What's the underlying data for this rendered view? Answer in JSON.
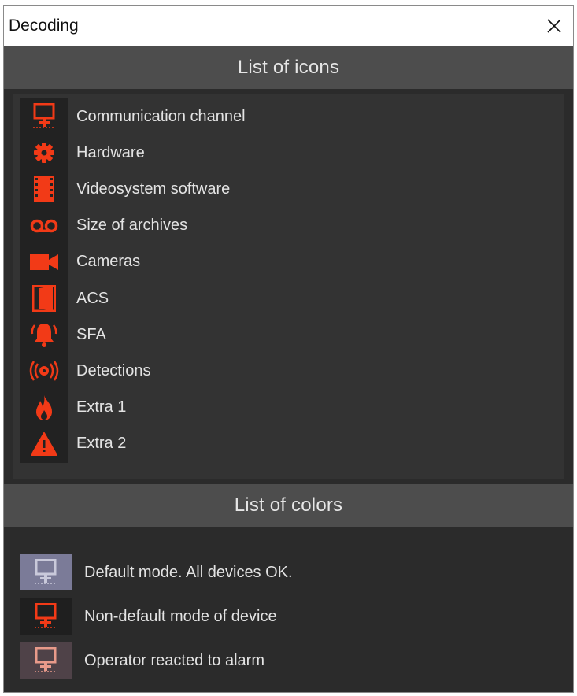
{
  "window": {
    "title": "Decoding"
  },
  "icons_section": {
    "header": "List of icons",
    "items": [
      {
        "icon": "monitor-network-icon",
        "label": "Communication channel"
      },
      {
        "icon": "gear-icon",
        "label": "Hardware"
      },
      {
        "icon": "film-strip-icon",
        "label": "Videosystem software"
      },
      {
        "icon": "voicemail-tape-icon",
        "label": "Size of archives"
      },
      {
        "icon": "video-camera-icon",
        "label": "Cameras"
      },
      {
        "icon": "door-icon",
        "label": "ACS"
      },
      {
        "icon": "alarm-bell-icon",
        "label": "SFA"
      },
      {
        "icon": "broadcast-signal-icon",
        "label": "Detections"
      },
      {
        "icon": "flame-icon",
        "label": "Extra 1"
      },
      {
        "icon": "warning-triangle-icon",
        "label": "Extra 2"
      }
    ]
  },
  "colors_section": {
    "header": "List of colors",
    "items": [
      {
        "label": "Default mode. All devices OK.",
        "swatch_bg": "#7b7b98",
        "icon_color": "#c9c9da"
      },
      {
        "label": "Non-default mode of device",
        "swatch_bg": "#1f1f1f",
        "icon_color": "#f23a17"
      },
      {
        "label": "Operator reacted to alarm",
        "swatch_bg": "#4f4248",
        "icon_color": "#e89a8a"
      }
    ]
  },
  "colors": {
    "accent": "#f23a17",
    "panel_bg": "#2b2b2b",
    "header_bg": "#4d4d4d",
    "text": "#e3e3e3"
  }
}
